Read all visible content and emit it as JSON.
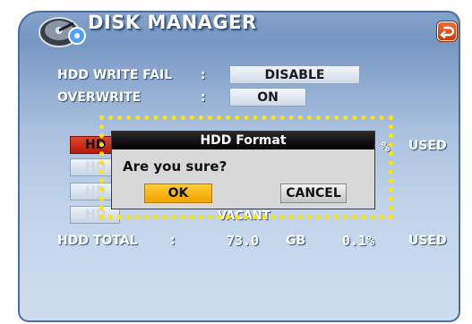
{
  "header": {
    "title": "DISK MANAGER",
    "back_icon": "return-arrow-icon",
    "logo_icon": "hard-disk-gear-icon"
  },
  "settings": [
    {
      "label": "HDD WRITE FAIL",
      "separator": ":",
      "value": "DISABLE"
    },
    {
      "label": "OVERWRITE",
      "separator": ":",
      "value": "ON"
    }
  ],
  "hdd_list": {
    "items": [
      {
        "label": "HD",
        "active": true
      },
      {
        "label": "HD",
        "active": false
      },
      {
        "label": "HD",
        "active": false
      },
      {
        "label": "HD",
        "active": false
      }
    ],
    "percent_suffix": "%",
    "used_label": "USED",
    "vacant_label": "VACANT"
  },
  "total": {
    "label": "HDD TOTAL",
    "separator": ":",
    "size": "73.0",
    "unit": "GB",
    "percent": "0.1%",
    "used_label": "USED"
  },
  "dialog": {
    "title": "HDD Format",
    "message": "Are you sure?",
    "ok_label": "OK",
    "cancel_label": "CANCEL"
  },
  "colors": {
    "focus_ring": "#ffe600",
    "ok_button": "#f0a400",
    "active_hdd": "#c8280f",
    "window_gradient_top": "#5d84b6",
    "window_gradient_bottom": "#cfdcee"
  }
}
